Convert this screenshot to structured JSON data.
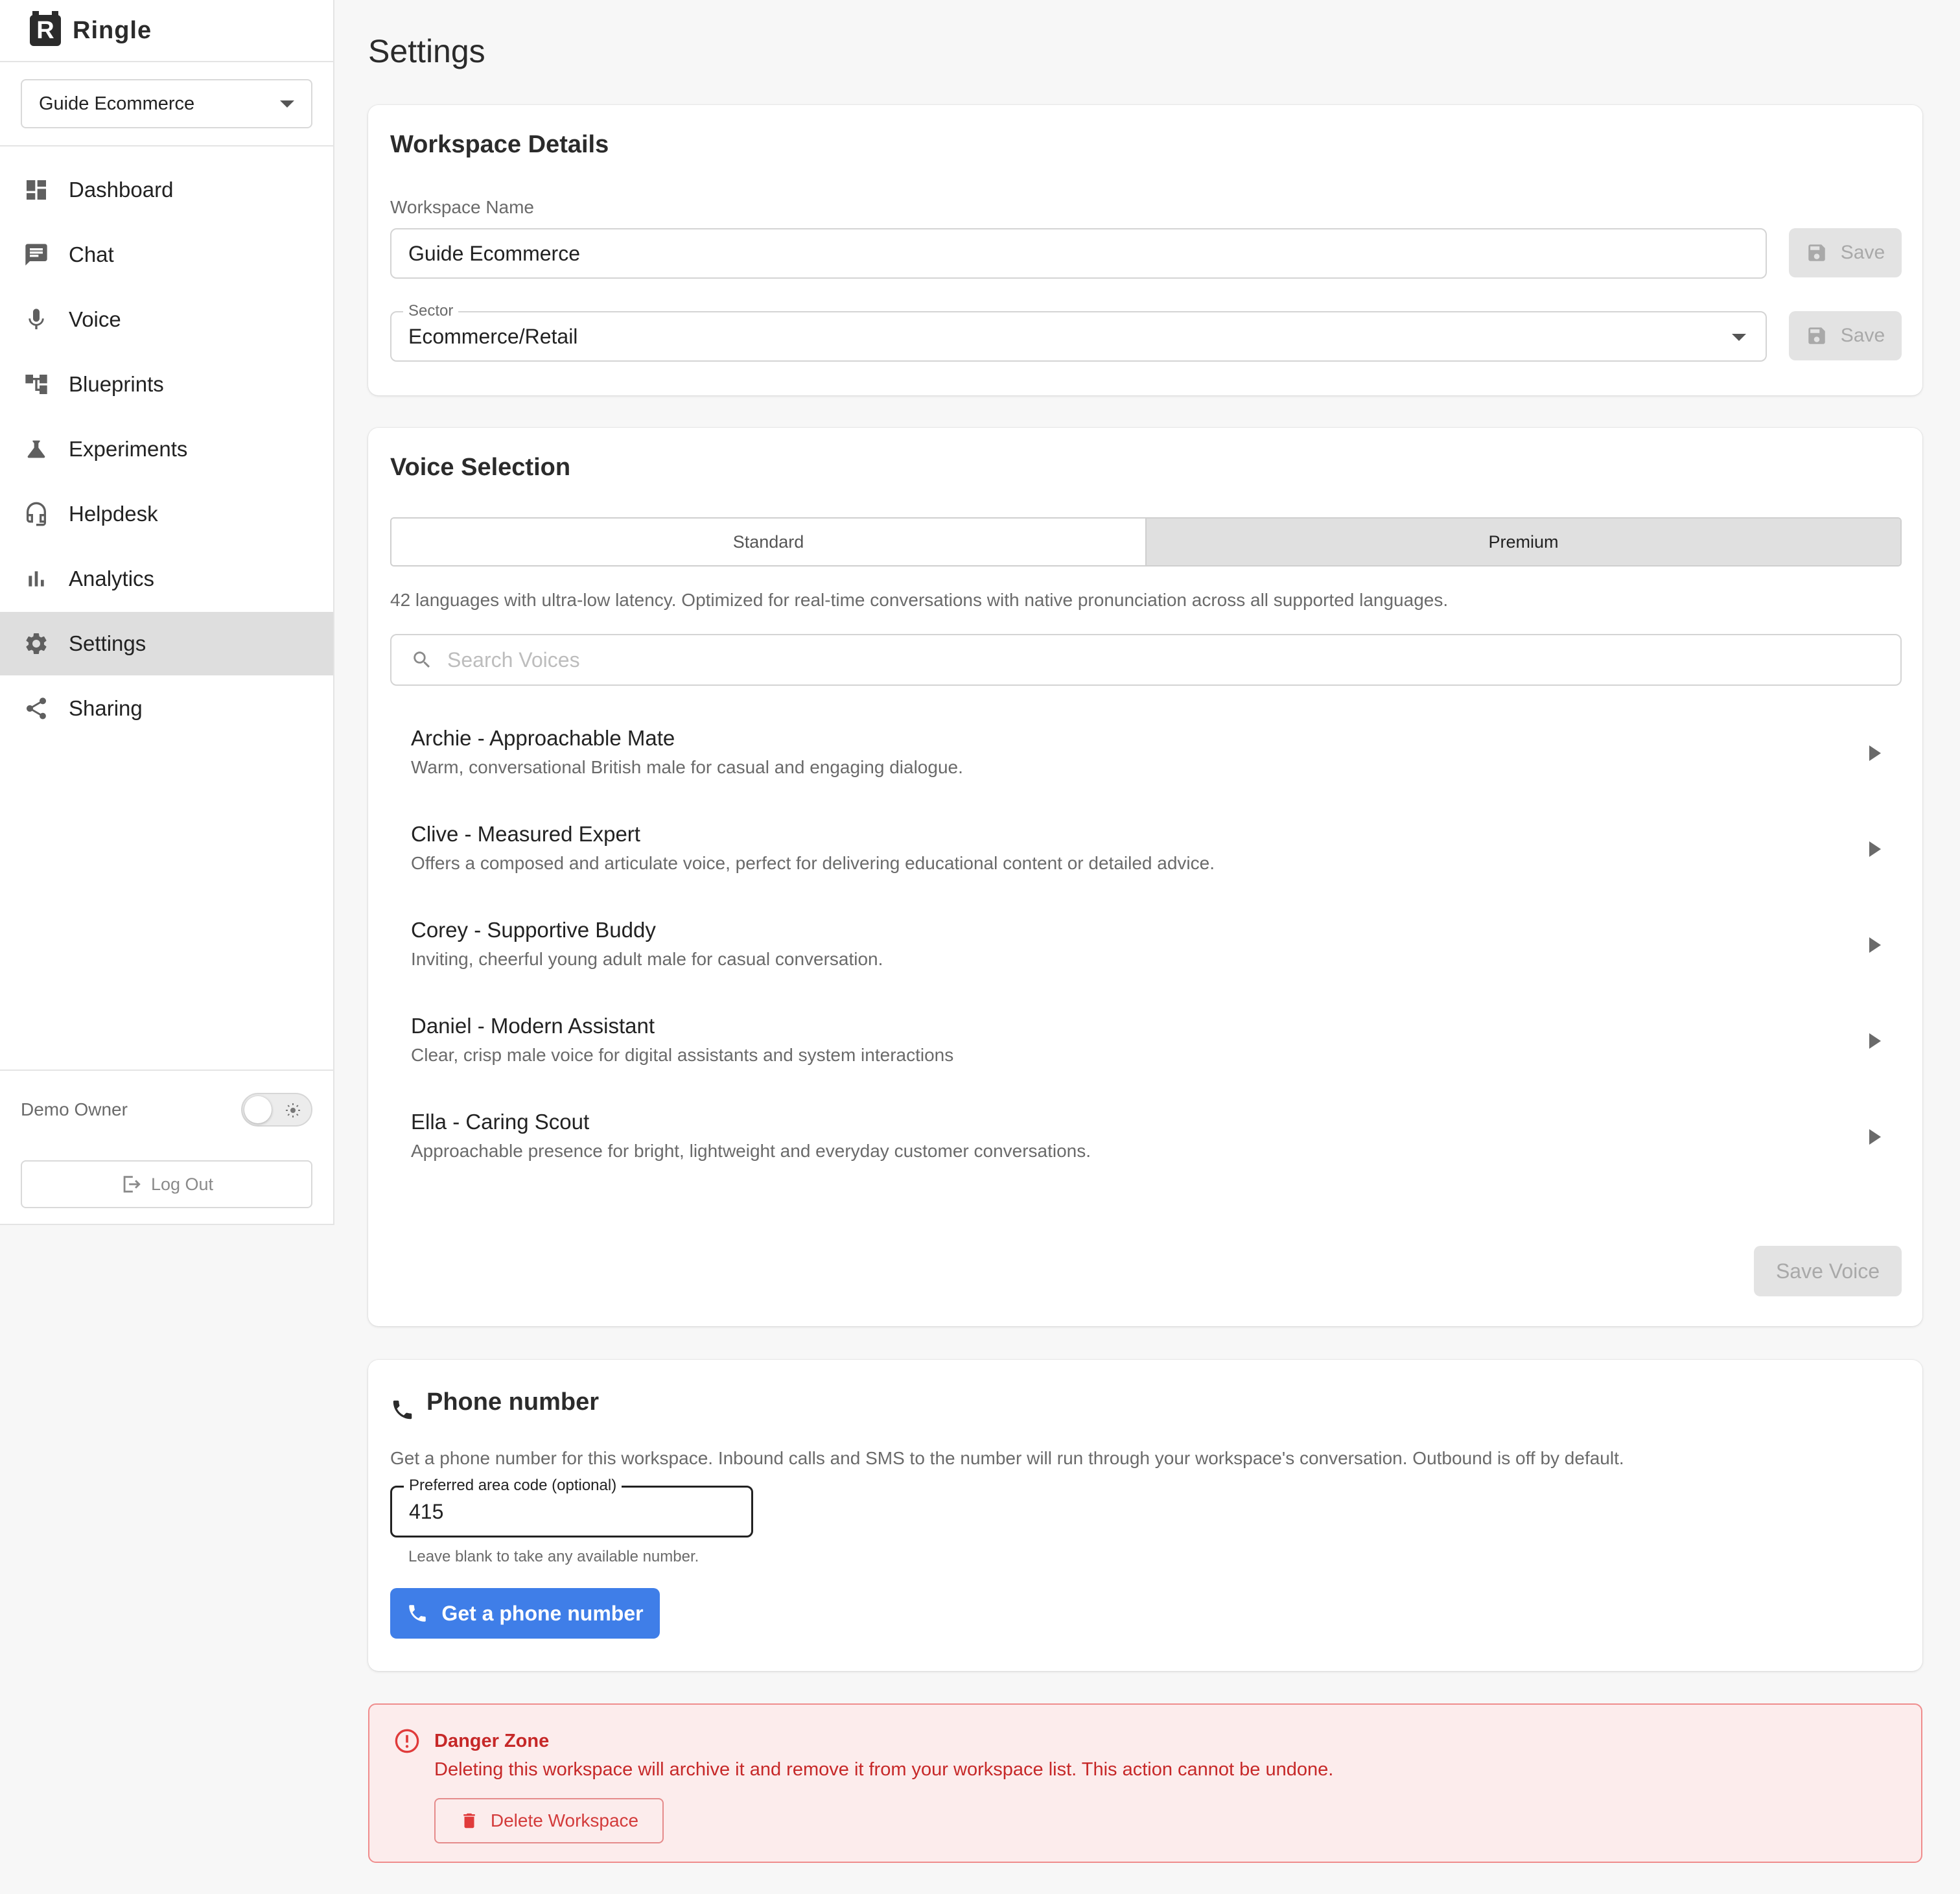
{
  "brand": {
    "name": "Ringle",
    "logo_letter": "R"
  },
  "workspace_switcher": {
    "selected": "Guide Ecommerce"
  },
  "nav": [
    {
      "label": "Dashboard",
      "icon": "dashboard-icon"
    },
    {
      "label": "Chat",
      "icon": "chat-icon"
    },
    {
      "label": "Voice",
      "icon": "microphone-icon"
    },
    {
      "label": "Blueprints",
      "icon": "blueprint-icon"
    },
    {
      "label": "Experiments",
      "icon": "flask-icon"
    },
    {
      "label": "Helpdesk",
      "icon": "headset-icon"
    },
    {
      "label": "Analytics",
      "icon": "bar-chart-icon"
    },
    {
      "label": "Settings",
      "icon": "gear-icon",
      "active": true
    },
    {
      "label": "Sharing",
      "icon": "share-icon"
    }
  ],
  "footer": {
    "user": "Demo Owner",
    "logout_label": "Log Out",
    "theme": "light"
  },
  "page": {
    "title": "Settings"
  },
  "workspace_details": {
    "title": "Workspace Details",
    "name_label": "Workspace Name",
    "name_value": "Guide Ecommerce",
    "sector_label": "Sector",
    "sector_value": "Ecommerce/Retail",
    "save_label": "Save"
  },
  "voice_selection": {
    "title": "Voice Selection",
    "tabs": [
      {
        "label": "Standard"
      },
      {
        "label": "Premium",
        "selected": true
      }
    ],
    "description": "42 languages with ultra-low latency. Optimized for real-time conversations with native pronunciation across all supported languages.",
    "search_placeholder": "Search Voices",
    "voices": [
      {
        "name": "Archie - Approachable Mate",
        "description": "Warm, conversational British male for casual and engaging dialogue."
      },
      {
        "name": "Clive - Measured Expert",
        "description": "Offers a composed and articulate voice, perfect for delivering educational content or detailed advice."
      },
      {
        "name": "Corey - Supportive Buddy",
        "description": "Inviting, cheerful young adult male for casual conversation."
      },
      {
        "name": "Daniel - Modern Assistant",
        "description": "Clear, crisp male voice for digital assistants and system interactions"
      },
      {
        "name": "Ella - Caring Scout",
        "description": "Approachable presence for bright, lightweight and everyday customer conversations."
      }
    ],
    "save_label": "Save Voice"
  },
  "phone": {
    "title": "Phone number",
    "description": "Get a phone number for this workspace. Inbound calls and SMS to the number will run through your workspace's conversation. Outbound is off by default.",
    "area_code_label": "Preferred area code (optional)",
    "area_code_value": "415",
    "helper": "Leave blank to take any available number.",
    "button_label": "Get a phone number"
  },
  "danger": {
    "title": "Danger Zone",
    "text": "Deleting this workspace will archive it and remove it from your workspace list. This action cannot be undone.",
    "button_label": "Delete Workspace"
  },
  "colors": {
    "primary": "#3f7ee8",
    "danger": "#c62828",
    "danger_bg": "#fcecec",
    "active_nav": "#dedede"
  }
}
